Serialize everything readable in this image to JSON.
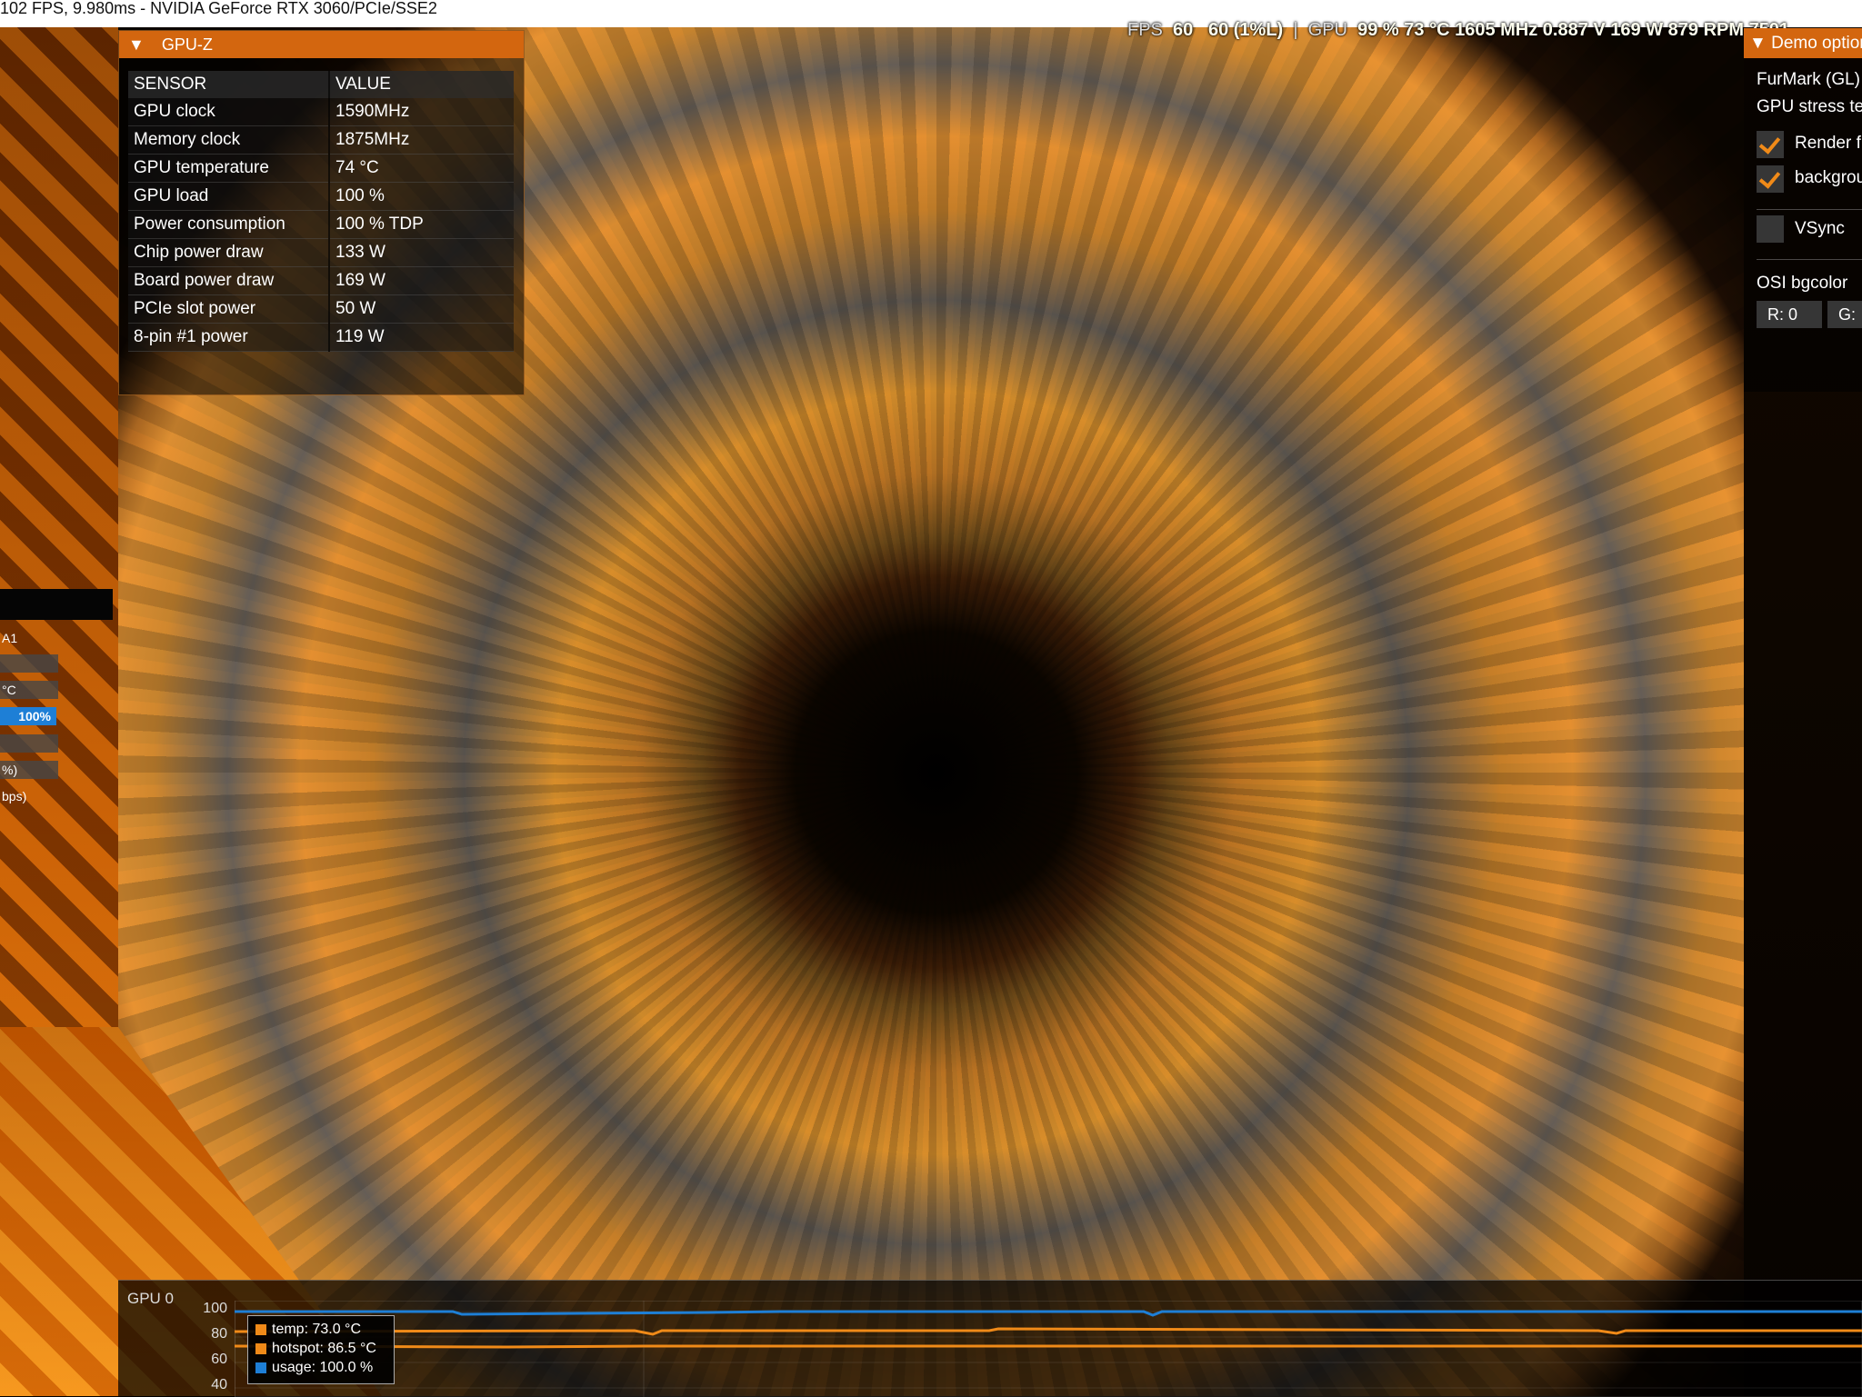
{
  "window": {
    "title": "102 FPS, 9.980ms - NVIDIA GeForce RTX 3060/PCIe/SSE2"
  },
  "osi": {
    "fps_label": "FPS",
    "fps_value": "60",
    "fps_1pct": "60 (1%L)",
    "separator": "|",
    "gpu_label": "GPU",
    "gpu_stats": "99 % 73 °C 1605 MHz 0.887 V 169 W 879 RPM 7501"
  },
  "gpuz": {
    "title": "GPU-Z",
    "col_sensor": "SENSOR",
    "col_value": "VALUE",
    "rows": [
      {
        "sensor": "GPU clock",
        "value": "1590MHz"
      },
      {
        "sensor": "Memory clock",
        "value": "1875MHz"
      },
      {
        "sensor": "GPU temperature",
        "value": "74 °C"
      },
      {
        "sensor": "GPU load",
        "value": "100 %"
      },
      {
        "sensor": "Power consumption",
        "value": "100 % TDP"
      },
      {
        "sensor": "Chip power draw",
        "value": "133 W"
      },
      {
        "sensor": "Board power draw",
        "value": "169 W"
      },
      {
        "sensor": "PCIe slot power",
        "value": "50 W"
      },
      {
        "sensor": "8-pin #1 power",
        "value": "119 W"
      }
    ]
  },
  "left_panel": {
    "row1": "A1",
    "row2": "",
    "row3": "°C",
    "row4": "100%",
    "row5": "",
    "row6": "%)",
    "row7": "bps)"
  },
  "demo_options": {
    "title": "Demo options",
    "app_name": "FurMark (GL)",
    "subtitle": "GPU stress test",
    "render_label": "Render f",
    "background_label": "backgrou",
    "vsync_label": "VSync",
    "render_checked": true,
    "background_checked": true,
    "vsync_checked": false,
    "osi_bgcolor_label": "OSI bgcolor",
    "r_field": "R: 0",
    "g_field": "G:"
  },
  "graph": {
    "title": "GPU 0",
    "y_ticks": [
      "100",
      "80",
      "60",
      "40"
    ],
    "legend": [
      {
        "label": "temp: 73.0 °C",
        "color": "#f08a18"
      },
      {
        "label": "hotspot: 86.5 °C",
        "color": "#f08a18"
      },
      {
        "label": "usage: 100.0 %",
        "color": "#1e7fd6"
      }
    ]
  },
  "colors": {
    "accent": "#d3660f",
    "usage_line": "#1e7fd6",
    "temp_line": "#f08a18"
  }
}
